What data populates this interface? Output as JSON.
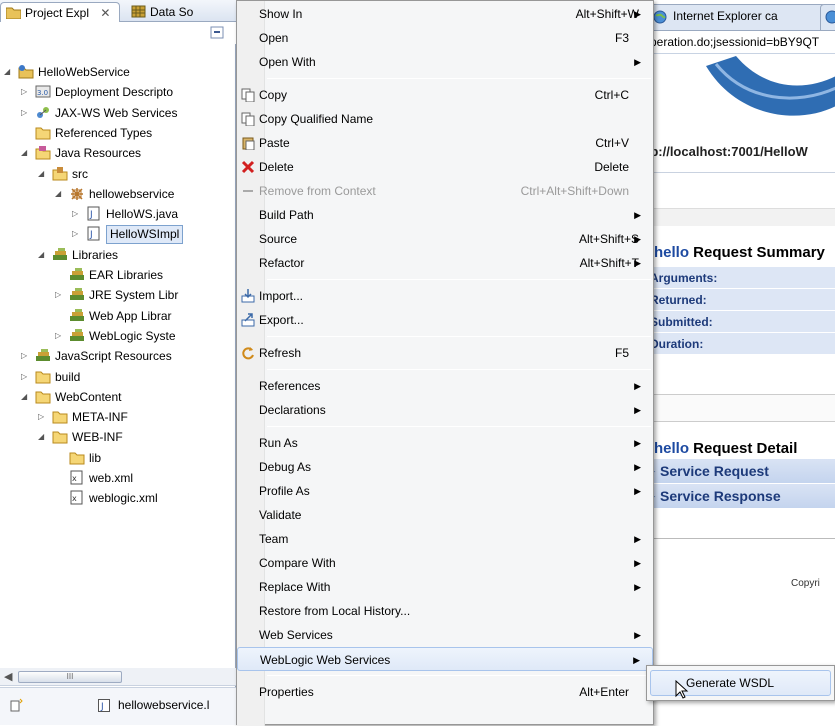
{
  "explorer": {
    "tab_active": "Project Expl",
    "tab_close": "✕",
    "tab_other": "Data So",
    "tree": [
      {
        "label": "HelloWebService",
        "depth": 0,
        "twisty": "open",
        "icon": "project-icon"
      },
      {
        "label": "Deployment Descripto",
        "depth": 1,
        "twisty": "closed",
        "icon": "deployment-descriptor-icon"
      },
      {
        "label": "JAX-WS Web Services",
        "depth": 1,
        "twisty": "closed",
        "icon": "web-services-icon"
      },
      {
        "label": "Referenced Types",
        "depth": 1,
        "twisty": "none",
        "icon": "folder-icon"
      },
      {
        "label": "Java Resources",
        "depth": 1,
        "twisty": "open",
        "icon": "java-resources-icon"
      },
      {
        "label": "src",
        "depth": 2,
        "twisty": "open",
        "icon": "source-folder-icon"
      },
      {
        "label": "hellowebservice",
        "depth": 3,
        "twisty": "open",
        "icon": "package-icon"
      },
      {
        "label": "HelloWS.java",
        "depth": 4,
        "twisty": "closed",
        "icon": "java-file-icon"
      },
      {
        "label": "HelloWSImpl",
        "depth": 4,
        "twisty": "closed",
        "icon": "java-file-icon",
        "selected": true
      },
      {
        "label": "Libraries",
        "depth": 2,
        "twisty": "open",
        "icon": "library-icon"
      },
      {
        "label": "EAR Libraries",
        "depth": 3,
        "twisty": "none",
        "icon": "library-icon"
      },
      {
        "label": "JRE System Libr",
        "depth": 3,
        "twisty": "closed",
        "icon": "library-icon"
      },
      {
        "label": "Web App Librar",
        "depth": 3,
        "twisty": "none",
        "icon": "library-icon"
      },
      {
        "label": "WebLogic Syste",
        "depth": 3,
        "twisty": "closed",
        "icon": "library-icon"
      },
      {
        "label": "JavaScript Resources",
        "depth": 1,
        "twisty": "closed",
        "icon": "library-icon"
      },
      {
        "label": "build",
        "depth": 1,
        "twisty": "closed",
        "icon": "folder-icon"
      },
      {
        "label": "WebContent",
        "depth": 1,
        "twisty": "open",
        "icon": "folder-icon"
      },
      {
        "label": "META-INF",
        "depth": 2,
        "twisty": "closed",
        "icon": "folder-icon"
      },
      {
        "label": "WEB-INF",
        "depth": 2,
        "twisty": "open",
        "icon": "folder-icon"
      },
      {
        "label": "lib",
        "depth": 3,
        "twisty": "none",
        "icon": "folder-icon"
      },
      {
        "label": "web.xml",
        "depth": 3,
        "twisty": "none",
        "icon": "xml-file-icon"
      },
      {
        "label": "weblogic.xml",
        "depth": 3,
        "twisty": "none",
        "icon": "xml-file-icon"
      }
    ],
    "scrollbar_grip": "III",
    "bottom_label": "hellowebservice.l"
  },
  "browser": {
    "tab1": "Internet Explorer ca",
    "url": "peration.do;jsessionid=bBY9QT",
    "endpoint": "tp://localhost:7001/HelloW",
    "summary_title_prefix": "hello",
    "summary_title": " Request Summary",
    "summary_rows": [
      "Arguments:",
      "Returned:",
      "Submitted:",
      "Duration:"
    ],
    "detail_title_prefix": "hello",
    "detail_title": " Request Detail",
    "detail_rows": [
      "Service Request",
      "Service Response"
    ],
    "copyright": "Copyri"
  },
  "menu": {
    "items": [
      {
        "label": "Show In",
        "shortcut": "Alt+Shift+W",
        "submenu": true
      },
      {
        "label": "Open",
        "shortcut": "F3"
      },
      {
        "label": "Open With",
        "submenu": true
      },
      {
        "sep": true
      },
      {
        "label": "Copy",
        "shortcut": "Ctrl+C",
        "icon": "copy-icon"
      },
      {
        "label": "Copy Qualified Name",
        "icon": "copy-qualified-icon"
      },
      {
        "label": "Paste",
        "shortcut": "Ctrl+V",
        "icon": "paste-icon"
      },
      {
        "label": "Delete",
        "shortcut": "Delete",
        "icon": "delete-icon"
      },
      {
        "label": "Remove from Context",
        "shortcut": "Ctrl+Alt+Shift+Down",
        "disabled": true,
        "icon": "remove-context-icon"
      },
      {
        "label": "Build Path",
        "submenu": true
      },
      {
        "label": "Source",
        "shortcut": "Alt+Shift+S",
        "submenu": true
      },
      {
        "label": "Refactor",
        "shortcut": "Alt+Shift+T",
        "submenu": true
      },
      {
        "sep": true
      },
      {
        "label": "Import...",
        "icon": "import-icon"
      },
      {
        "label": "Export...",
        "icon": "export-icon"
      },
      {
        "sep": true
      },
      {
        "label": "Refresh",
        "shortcut": "F5",
        "icon": "refresh-icon"
      },
      {
        "sep": true
      },
      {
        "label": "References",
        "submenu": true
      },
      {
        "label": "Declarations",
        "submenu": true
      },
      {
        "sep": true
      },
      {
        "label": "Run As",
        "submenu": true
      },
      {
        "label": "Debug As",
        "submenu": true
      },
      {
        "label": "Profile As",
        "submenu": true
      },
      {
        "label": "Validate"
      },
      {
        "label": "Team",
        "submenu": true
      },
      {
        "label": "Compare With",
        "submenu": true
      },
      {
        "label": "Replace With",
        "submenu": true
      },
      {
        "label": "Restore from Local History..."
      },
      {
        "label": "Web Services",
        "submenu": true
      },
      {
        "label": "WebLogic Web Services",
        "submenu": true,
        "highlight": true
      },
      {
        "sep": true
      },
      {
        "label": "Properties",
        "shortcut": "Alt+Enter"
      }
    ]
  },
  "submenu": {
    "item": "Generate WSDL"
  }
}
